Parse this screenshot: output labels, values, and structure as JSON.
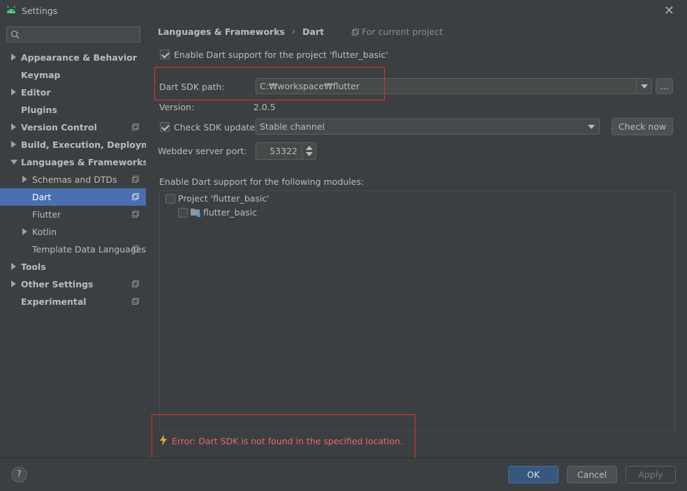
{
  "window": {
    "title": "Settings",
    "close_glyph": "✕"
  },
  "sidebar": {
    "search": {
      "placeholder": "",
      "value": ""
    },
    "items": [
      {
        "label": "Appearance & Behavior",
        "arrow": "right",
        "bold": true
      },
      {
        "label": "Keymap",
        "arrow": "none",
        "bold": true
      },
      {
        "label": "Editor",
        "arrow": "right",
        "bold": true
      },
      {
        "label": "Plugins",
        "arrow": "none",
        "bold": true
      },
      {
        "label": "Version Control",
        "arrow": "right",
        "bold": true,
        "copy_icon": true
      },
      {
        "label": "Build, Execution, Deployment",
        "arrow": "right",
        "bold": true
      },
      {
        "label": "Languages & Frameworks",
        "arrow": "down",
        "bold": true
      },
      {
        "label": "Schemas and DTDs",
        "arrow": "right",
        "bold": false,
        "copy_icon": true
      },
      {
        "label": "Dart",
        "arrow": "none",
        "bold": false,
        "copy_icon": true,
        "selected": true
      },
      {
        "label": "Flutter",
        "arrow": "none",
        "bold": false,
        "copy_icon": true
      },
      {
        "label": "Kotlin",
        "arrow": "right",
        "bold": false
      },
      {
        "label": "Template Data Languages",
        "arrow": "none",
        "bold": false,
        "copy_icon": true
      },
      {
        "label": "Tools",
        "arrow": "right",
        "bold": true
      },
      {
        "label": "Other Settings",
        "arrow": "right",
        "bold": true,
        "copy_icon": true
      },
      {
        "label": "Experimental",
        "arrow": "none",
        "bold": true,
        "copy_icon": true
      }
    ]
  },
  "breadcrumb": {
    "parent": "Languages & Frameworks",
    "separator": "›",
    "current": "Dart",
    "scope": "For current project"
  },
  "dart": {
    "enable_label": "Enable Dart support for the project 'flutter_basic'",
    "enable_checked": true,
    "sdk_path_label": "Dart SDK path:",
    "sdk_path_value": "C:₩workspace₩flutter",
    "browse_label": "...",
    "version_label": "Version:",
    "version_value": "2.0.5",
    "check_update_label": "Check SDK update:",
    "check_update_checked": true,
    "channel_value": "Stable channel",
    "check_now_label": "Check now",
    "webdev_label": "Webdev server port:",
    "webdev_port": "53322",
    "modules_label": "Enable Dart support for the following modules:",
    "modules": [
      {
        "label": "Project 'flutter_basic'",
        "checked": false
      },
      {
        "label": "flutter_basic",
        "checked": false
      }
    ],
    "error_text": "Error: Dart SDK is not found in the specified location."
  },
  "footer": {
    "help_label": "?",
    "ok_label": "OK",
    "cancel_label": "Cancel",
    "apply_label": "Apply"
  },
  "colors": {
    "background": "#3c3f41",
    "selection": "#4b6eaf",
    "error": "#e06a66",
    "highlight_box": "#e03131",
    "primary_button": "#365880"
  }
}
